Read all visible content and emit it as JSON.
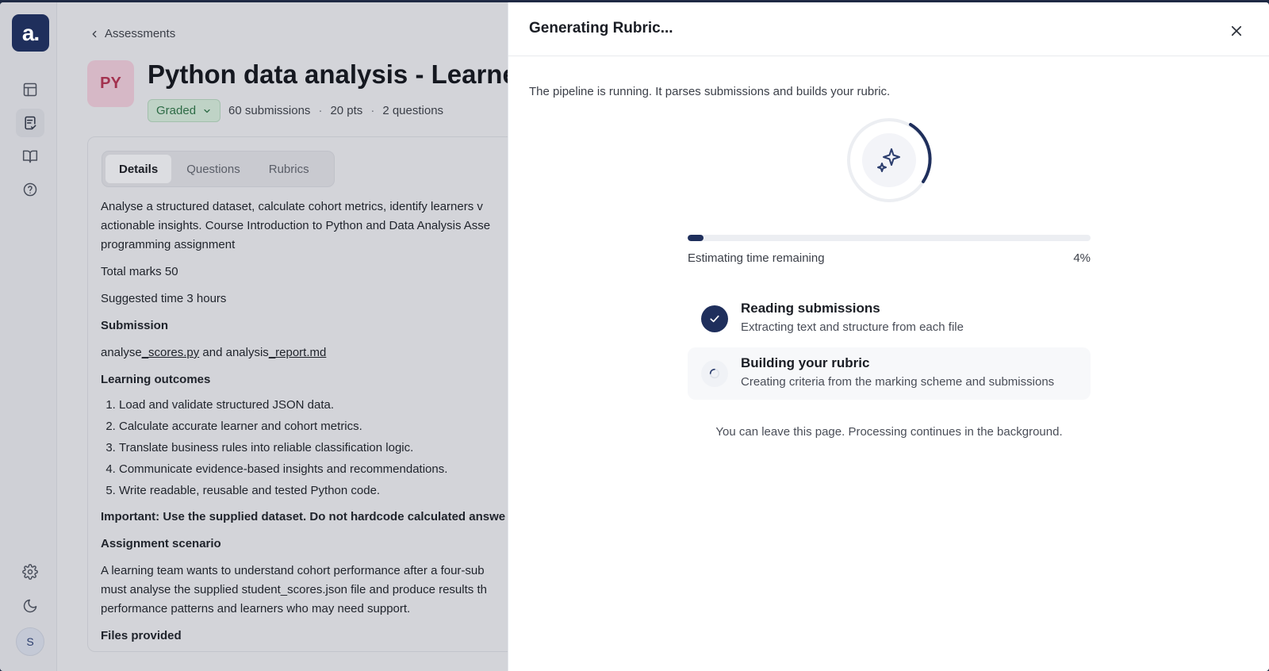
{
  "sidebar": {
    "logo_text": "a.",
    "items": [
      {
        "icon": "layout-icon"
      },
      {
        "icon": "clipboard-check-icon",
        "active": true
      },
      {
        "icon": "book-open-icon"
      },
      {
        "icon": "help-circle-icon"
      }
    ],
    "bottom": [
      {
        "icon": "gear-icon"
      },
      {
        "icon": "moon-icon"
      }
    ],
    "avatar_initial": "S"
  },
  "page": {
    "breadcrumb": "Assessments",
    "badge": "PY",
    "title": "Python data analysis - Learner",
    "status": "Graded",
    "submissions": "60 submissions",
    "points": "20 pts",
    "questions": "2 questions",
    "separator": "·",
    "tabs": [
      {
        "label": "Details",
        "active": true
      },
      {
        "label": "Questions"
      },
      {
        "label": "Rubrics"
      }
    ],
    "details": {
      "intro_line1": "Analyse a structured dataset, calculate cohort metrics, identify learners v",
      "intro_line2": "actionable insights. Course Introduction to Python and Data Analysis Asse",
      "intro_line3": "programming assignment",
      "total_marks": "Total marks 50",
      "suggested_time": "Suggested time 3 hours",
      "submission_heading": "Submission",
      "submission_part1": "analyse",
      "submission_link1": "_scores.py",
      "submission_part2": " and analysis",
      "submission_link2": "_report.md",
      "outcomes_heading": "Learning outcomes",
      "outcomes": [
        "Load and validate structured JSON data.",
        "Calculate accurate learner and cohort metrics.",
        "Translate business rules into reliable classification logic.",
        "Communicate evidence-based insights and recommendations.",
        "Write readable, reusable and tested Python code."
      ],
      "important": "Important: Use the supplied dataset. Do not hardcode calculated answe",
      "scenario_heading": "Assignment scenario",
      "scenario_line1": "A learning team wants to understand cohort performance after a four-sub",
      "scenario_line2": "must analyse the supplied student_scores.json file and produce results th",
      "scenario_line3": "performance patterns and learners who may need support.",
      "files_heading": "Files provided"
    }
  },
  "drawer": {
    "title": "Generating Rubric...",
    "intro": "The pipeline is running. It parses submissions and builds your rubric.",
    "progress": {
      "label": "Estimating time remaining",
      "percent_text": "4%",
      "value": 0.04
    },
    "steps": [
      {
        "title": "Reading submissions",
        "desc": "Extracting text and structure from each file",
        "state": "done"
      },
      {
        "title": "Building your rubric",
        "desc": "Creating criteria from the marking scheme and submissions",
        "state": "active"
      }
    ],
    "note": "You can leave this page. Processing continues in the background."
  },
  "colors": {
    "brand": "#1f2f5c",
    "graded": "#2d6b45",
    "badge_text": "#a3324f"
  }
}
